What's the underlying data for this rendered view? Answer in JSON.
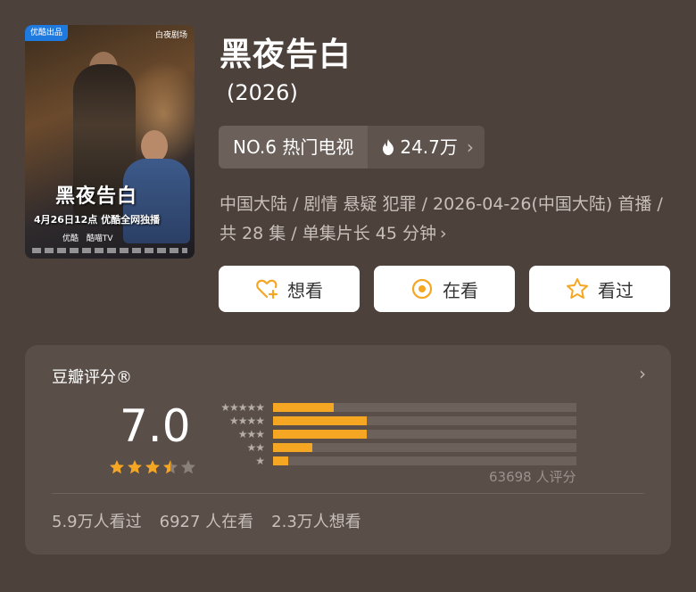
{
  "poster": {
    "badge": "优酷出品",
    "brand": "白夜剧场",
    "title": "黑夜告白",
    "date_line": "4月26日12点 优酷全网独播",
    "platforms": [
      "优酷",
      "酷喵TV"
    ]
  },
  "title": "黑夜告白",
  "year": "(2026)",
  "rank": {
    "label": "NO.6 热门电视",
    "heat": "24.7万",
    "fire_icon": "fire-icon",
    "accent": "#ffffff"
  },
  "meta": {
    "text": "中国大陆 / 剧情 悬疑 犯罪 / 2026-04-26(中国大陆) 首播 / 共 28 集 / 单集片长 45 分钟",
    "more": "›"
  },
  "actions": [
    {
      "label": "想看",
      "icon": "heart-plus-icon"
    },
    {
      "label": "在看",
      "icon": "target-icon"
    },
    {
      "label": "看过",
      "icon": "star-outline-icon"
    }
  ],
  "rating": {
    "label": "豆瓣评分®",
    "score": "7.0",
    "stars_value": 3.5,
    "star_color": "#f5a623",
    "distribution": [
      {
        "stars": 5,
        "fraction": 0.2
      },
      {
        "stars": 4,
        "fraction": 0.31
      },
      {
        "stars": 3,
        "fraction": 0.31
      },
      {
        "stars": 2,
        "fraction": 0.13
      },
      {
        "stars": 1,
        "fraction": 0.05
      }
    ],
    "votes": "63698 人评分"
  },
  "watch_stats": {
    "watched": "5.9万人看过",
    "watching": "6927 人在看",
    "want": "2.3万人想看"
  }
}
